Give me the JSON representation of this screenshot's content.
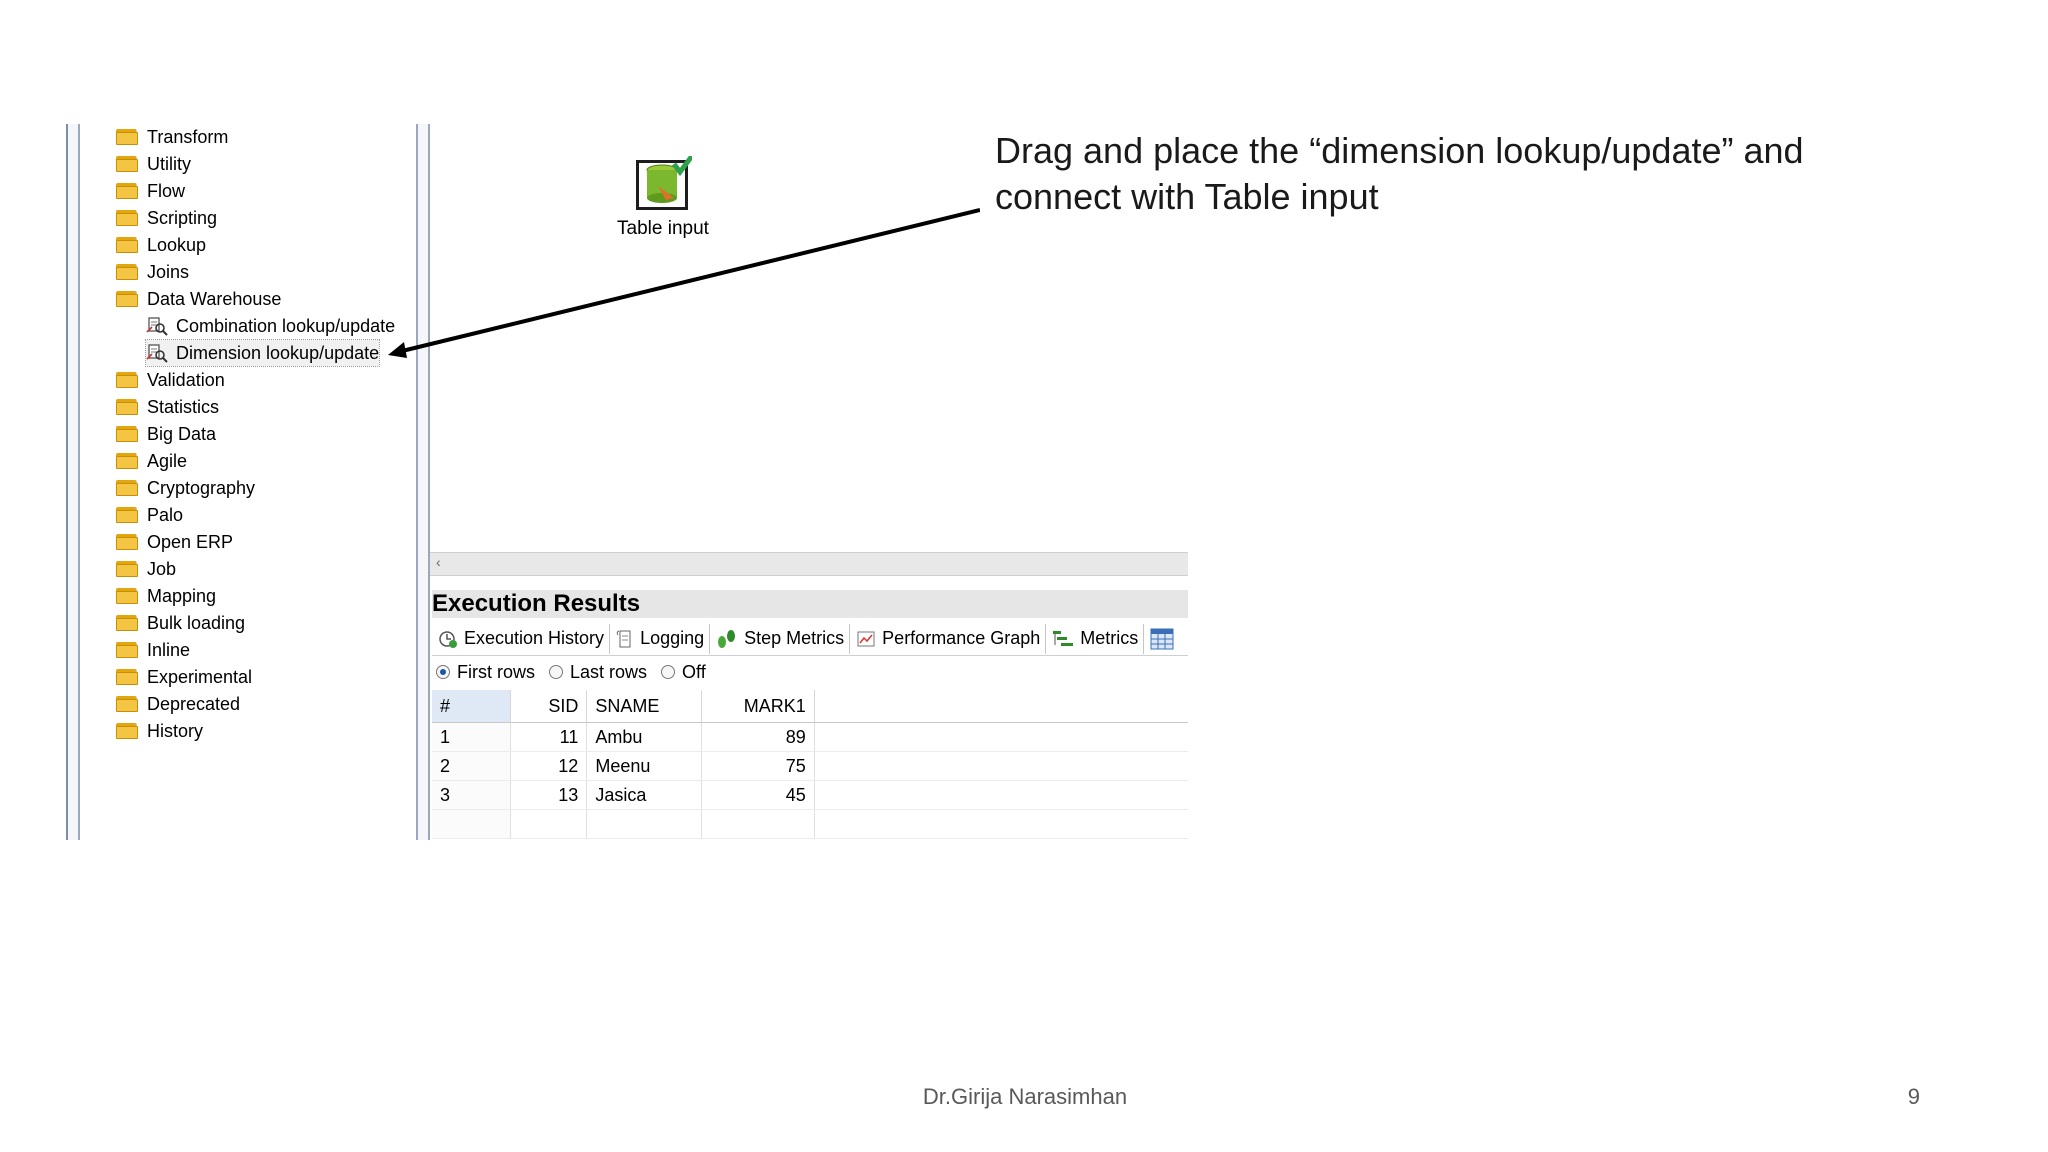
{
  "tree": {
    "items": [
      {
        "label": "Transform",
        "type": "folder"
      },
      {
        "label": "Utility",
        "type": "folder"
      },
      {
        "label": "Flow",
        "type": "folder"
      },
      {
        "label": "Scripting",
        "type": "folder"
      },
      {
        "label": "Lookup",
        "type": "folder"
      },
      {
        "label": "Joins",
        "type": "folder"
      },
      {
        "label": "Data Warehouse",
        "type": "folder"
      },
      {
        "label": "Combination lookup/update",
        "type": "step"
      },
      {
        "label": "Dimension lookup/update",
        "type": "step",
        "selected": true
      },
      {
        "label": "Validation",
        "type": "folder"
      },
      {
        "label": "Statistics",
        "type": "folder"
      },
      {
        "label": "Big Data",
        "type": "folder"
      },
      {
        "label": "Agile",
        "type": "folder"
      },
      {
        "label": "Cryptography",
        "type": "folder"
      },
      {
        "label": "Palo",
        "type": "folder"
      },
      {
        "label": "Open ERP",
        "type": "folder"
      },
      {
        "label": "Job",
        "type": "folder"
      },
      {
        "label": "Mapping",
        "type": "folder"
      },
      {
        "label": "Bulk loading",
        "type": "folder"
      },
      {
        "label": "Inline",
        "type": "folder"
      },
      {
        "label": "Experimental",
        "type": "folder"
      },
      {
        "label": "Deprecated",
        "type": "folder"
      },
      {
        "label": "History",
        "type": "folder"
      }
    ]
  },
  "canvas": {
    "step_label": "Table input",
    "step_icon": "table-input-icon"
  },
  "execution": {
    "title": "Execution Results",
    "tabs": [
      {
        "label": "Execution History",
        "icon": "execution-history-icon"
      },
      {
        "label": "Logging",
        "icon": "logging-icon"
      },
      {
        "label": "Step Metrics",
        "icon": "step-metrics-icon"
      },
      {
        "label": "Performance Graph",
        "icon": "performance-graph-icon"
      },
      {
        "label": "Metrics",
        "icon": "metrics-icon"
      }
    ],
    "radio": {
      "first": "First rows",
      "last": "Last rows",
      "off": "Off",
      "selected": "First rows"
    },
    "table": {
      "headers": [
        "#",
        "SID",
        "SNAME",
        "MARK1"
      ],
      "rows": [
        [
          "1",
          "11",
          "Ambu",
          "89"
        ],
        [
          "2",
          "12",
          "Meenu",
          "75"
        ],
        [
          "3",
          "13",
          "Jasica",
          "45"
        ]
      ]
    }
  },
  "annotation": {
    "line1": "Drag and place the “dimension lookup/update” and",
    "line2": "connect with Table input"
  },
  "footer": {
    "author": "Dr.Girija Narasimhan",
    "page": "9"
  },
  "colors": {
    "folder": "#f4c542",
    "selected_radio": "#1a55b0",
    "panel_border": "#9aa7bd"
  }
}
